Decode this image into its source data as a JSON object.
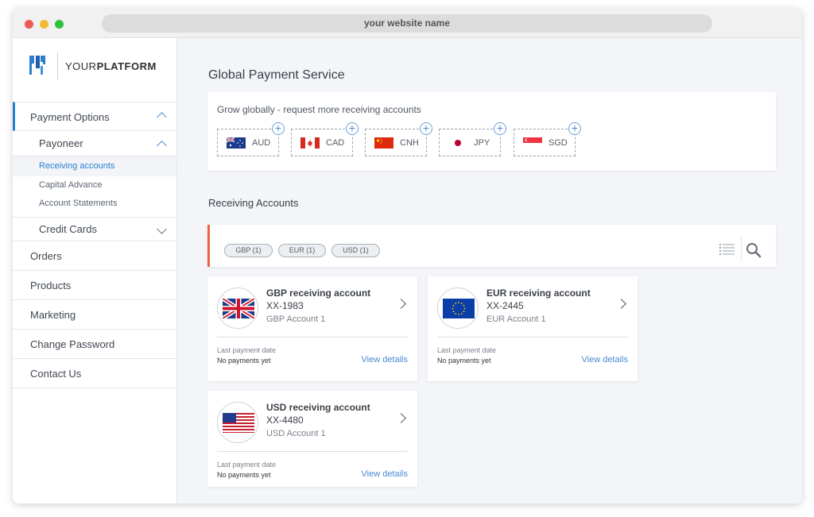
{
  "browser": {
    "url": "your website name"
  },
  "logo": {
    "prefix": "YOUR",
    "bold": "PLATFORM"
  },
  "sidebar": {
    "payment_options": "Payment Options",
    "payoneer": "Payoneer",
    "payoneer_items": [
      "Receiving accounts",
      "Capital Advance",
      "Account Statements"
    ],
    "credit_cards": "Credit Cards",
    "items": [
      "Orders",
      "Products",
      "Marketing",
      "Change Password",
      "Contact Us"
    ]
  },
  "main": {
    "title": "Global Payment Service",
    "grow_title": "Grow globally - request more receiving accounts",
    "currencies": [
      "AUD",
      "CAD",
      "CNH",
      "JPY",
      "SGD"
    ],
    "section_title": "Receiving Accounts",
    "filters": [
      "GBP (1)",
      "EUR (1)",
      "USD (1)"
    ],
    "accounts": [
      {
        "title": "GBP receiving account",
        "number": "XX-1983",
        "name": "GBP Account 1",
        "last_label": "Last payment date",
        "last_value": "No payments yet",
        "link": "View details"
      },
      {
        "title": "EUR receiving account",
        "number": "XX-2445",
        "name": "EUR Account 1",
        "last_label": "Last payment date",
        "last_value": "No payments yet",
        "link": "View details"
      },
      {
        "title": "USD receiving account",
        "number": "XX-4480",
        "name": "USD Account 1",
        "last_label": "Last payment date",
        "last_value": "No payments yet",
        "link": "View details"
      }
    ]
  },
  "colors": {
    "accent": "#2a7fd0",
    "highlight": "#e8663d"
  }
}
